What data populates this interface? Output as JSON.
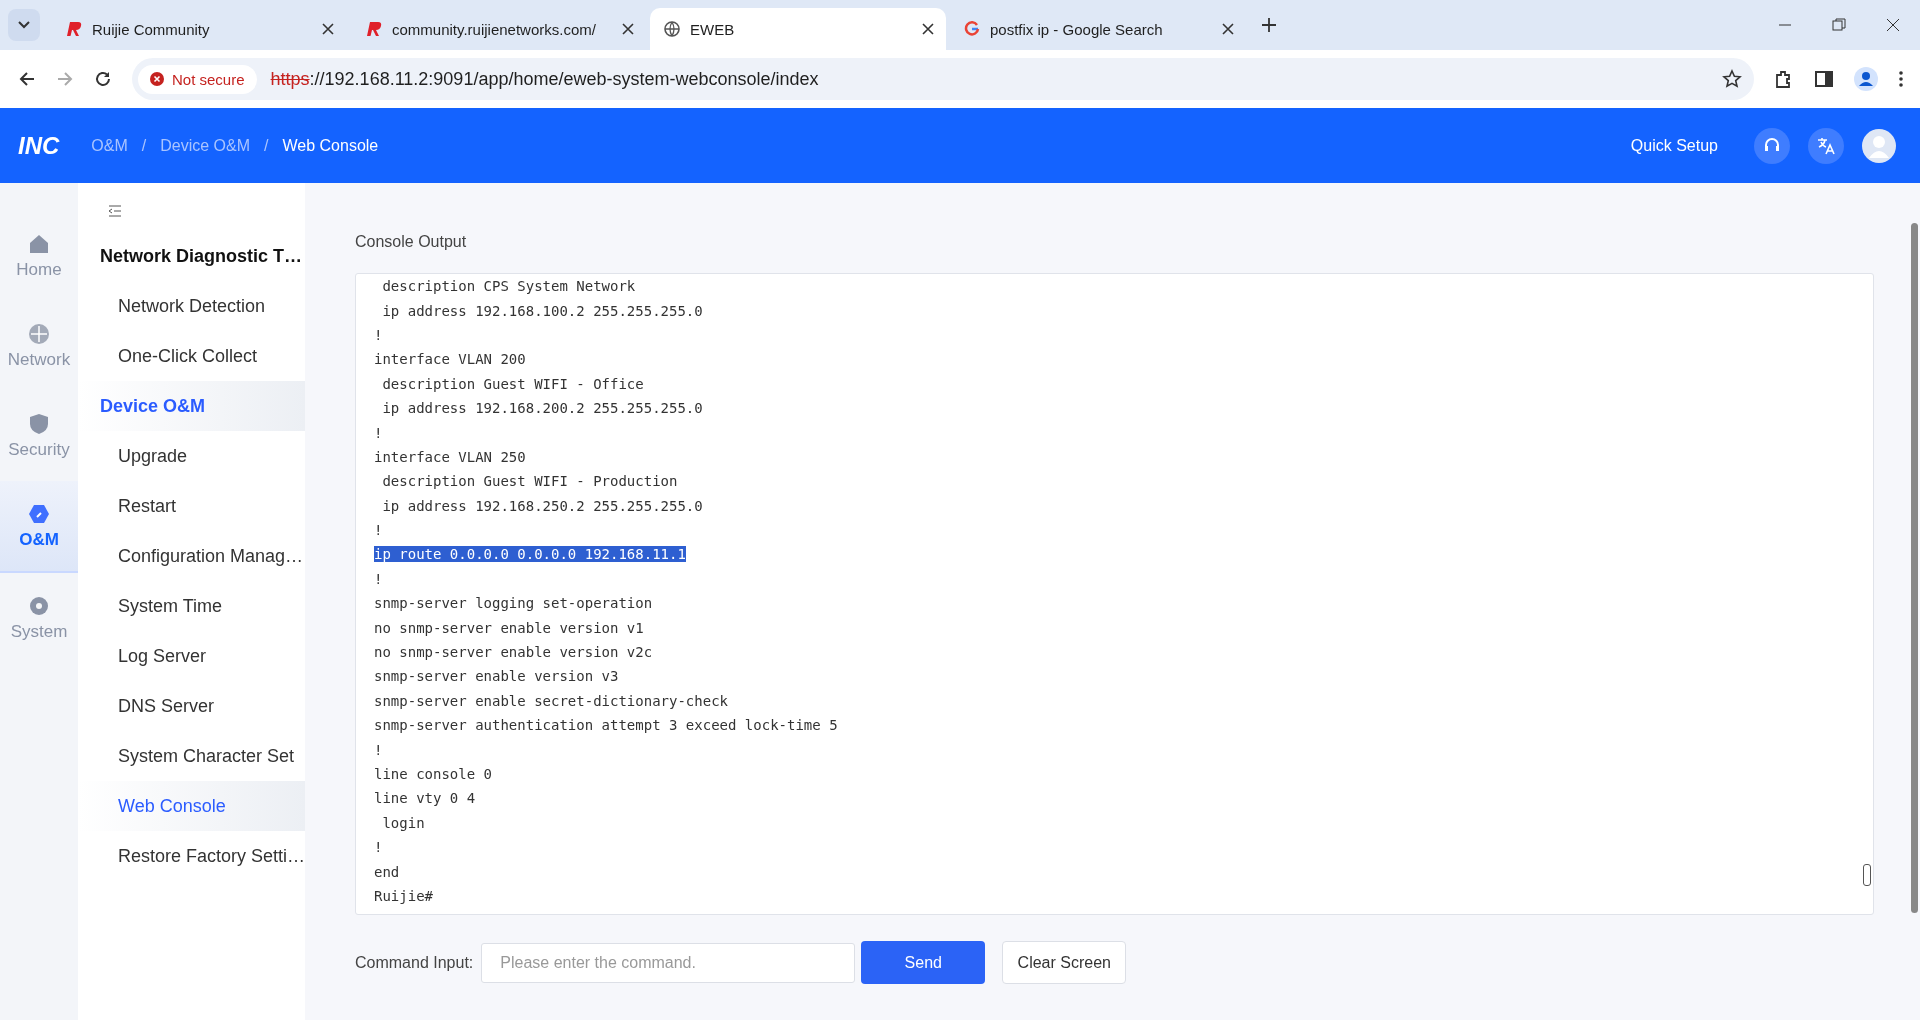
{
  "browser": {
    "tabs": [
      {
        "title": "Ruijie Community",
        "kind": "brand",
        "selected": false
      },
      {
        "title": "community.ruijienetworks.com/",
        "kind": "brand",
        "selected": false
      },
      {
        "title": "EWEB",
        "kind": "globe",
        "selected": true
      },
      {
        "title": "postfix ip - Google Search",
        "kind": "search",
        "selected": false
      }
    ],
    "security": "Not secure",
    "url_scheme": "https",
    "url_rest": "://192.168.11.2:9091/app/home/eweb-system-webconsole/index"
  },
  "header": {
    "logo": "INC",
    "breadcrumb": [
      {
        "label": "O&M",
        "selected": false
      },
      {
        "label": "Device O&M",
        "selected": false
      },
      {
        "label": "Web Console",
        "selected": true
      }
    ],
    "separator": "/",
    "quick_setup": "Quick Setup"
  },
  "rail": [
    {
      "label": "Home",
      "kind": "home",
      "selected": false
    },
    {
      "label": "Network",
      "kind": "network",
      "selected": false
    },
    {
      "label": "Security",
      "kind": "security",
      "selected": false
    },
    {
      "label": "O&M",
      "kind": "om",
      "selected": true
    },
    {
      "label": "System",
      "kind": "system",
      "selected": false
    }
  ],
  "sidebar": [
    {
      "label": "Network Diagnostic T…",
      "kind": "group",
      "selected": false
    },
    {
      "label": "Network Detection",
      "kind": "item",
      "selected": false
    },
    {
      "label": "One-Click Collect",
      "kind": "item",
      "selected": false
    },
    {
      "label": "Device O&M",
      "kind": "group",
      "selected": true
    },
    {
      "label": "Upgrade",
      "kind": "item",
      "selected": false
    },
    {
      "label": "Restart",
      "kind": "item",
      "selected": false
    },
    {
      "label": "Configuration Manag…",
      "kind": "item",
      "selected": false
    },
    {
      "label": "System Time",
      "kind": "item",
      "selected": false
    },
    {
      "label": "Log Server",
      "kind": "item",
      "selected": false
    },
    {
      "label": "DNS Server",
      "kind": "item",
      "selected": false
    },
    {
      "label": "System Character Set",
      "kind": "item",
      "selected": false
    },
    {
      "label": "Web Console",
      "kind": "item",
      "selected": true
    },
    {
      "label": "Restore Factory Setti…",
      "kind": "item",
      "selected": false
    }
  ],
  "console": {
    "title": "Console Output",
    "lines": [
      {
        "text": " description CPS System Network",
        "selected": false
      },
      {
        "text": " ip address 192.168.100.2 255.255.255.0",
        "selected": false
      },
      {
        "text": "!",
        "selected": false
      },
      {
        "text": "interface VLAN 200",
        "selected": false
      },
      {
        "text": " description Guest WIFI - Office",
        "selected": false
      },
      {
        "text": " ip address 192.168.200.2 255.255.255.0",
        "selected": false
      },
      {
        "text": "!",
        "selected": false
      },
      {
        "text": "interface VLAN 250",
        "selected": false
      },
      {
        "text": " description Guest WIFI - Production",
        "selected": false
      },
      {
        "text": " ip address 192.168.250.2 255.255.255.0",
        "selected": false
      },
      {
        "text": "!",
        "selected": false
      },
      {
        "text": "ip route 0.0.0.0 0.0.0.0 192.168.11.1",
        "selected": true
      },
      {
        "text": "!",
        "selected": false
      },
      {
        "text": "snmp-server logging set-operation",
        "selected": false
      },
      {
        "text": "no snmp-server enable version v1",
        "selected": false
      },
      {
        "text": "no snmp-server enable version v2c",
        "selected": false
      },
      {
        "text": "snmp-server enable version v3",
        "selected": false
      },
      {
        "text": "snmp-server enable secret-dictionary-check",
        "selected": false
      },
      {
        "text": "snmp-server authentication attempt 3 exceed lock-time 5",
        "selected": false
      },
      {
        "text": "!",
        "selected": false
      },
      {
        "text": "line console 0",
        "selected": false
      },
      {
        "text": "line vty 0 4",
        "selected": false
      },
      {
        "text": " login",
        "selected": false
      },
      {
        "text": "!",
        "selected": false
      },
      {
        "text": "end",
        "selected": false
      },
      {
        "text": "Ruijie#",
        "selected": false
      }
    ]
  },
  "command": {
    "label": "Command Input:",
    "placeholder": "Please enter the command.",
    "send": "Send",
    "clear": "Clear Screen"
  }
}
